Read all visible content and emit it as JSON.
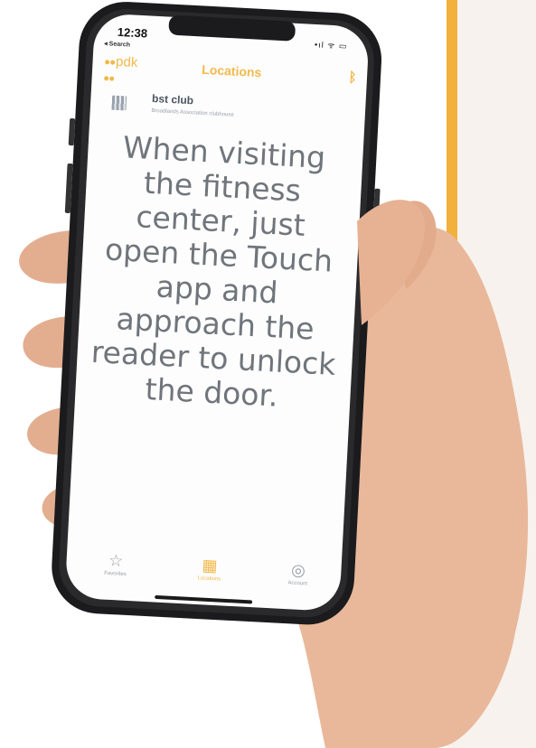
{
  "status_bar": {
    "time": "12:38",
    "back_label": "◂ Search",
    "signal_text": "•ıl ᯤ ▭"
  },
  "app": {
    "logo_text": "pdk",
    "nav_title": "Locations",
    "bluetooth_icon": "bluetooth-icon",
    "accent_color": "#f2b94c"
  },
  "location": {
    "name": "bst club",
    "subtitle": "Broadlands Association clubhouse",
    "icon": "building-icon"
  },
  "message": "When visiting the fitness center, just open the Touch app and approach the reader to unlock the door.",
  "tabs": [
    {
      "label": "Favorites",
      "icon": "star-icon"
    },
    {
      "label": "Locations",
      "icon": "building-icon"
    },
    {
      "label": "Account",
      "icon": "account-icon"
    }
  ]
}
